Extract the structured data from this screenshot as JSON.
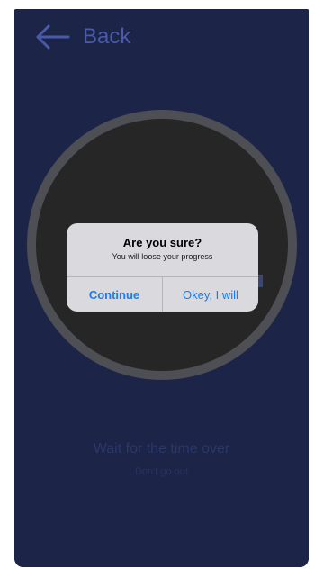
{
  "header": {
    "back_label": "Back",
    "back_icon": "arrow-left-icon"
  },
  "status": {
    "wait_title": "Wait for the time over",
    "wait_subtitle": "Don't go out"
  },
  "alert": {
    "title": "Are you sure?",
    "message": "You will loose your progress",
    "continue_label": "Continue",
    "confirm_label": "Okey, I will"
  },
  "colors": {
    "background": "#1c2447",
    "accent": "#4b5aa8",
    "alert_button": "#1a7cf5"
  }
}
